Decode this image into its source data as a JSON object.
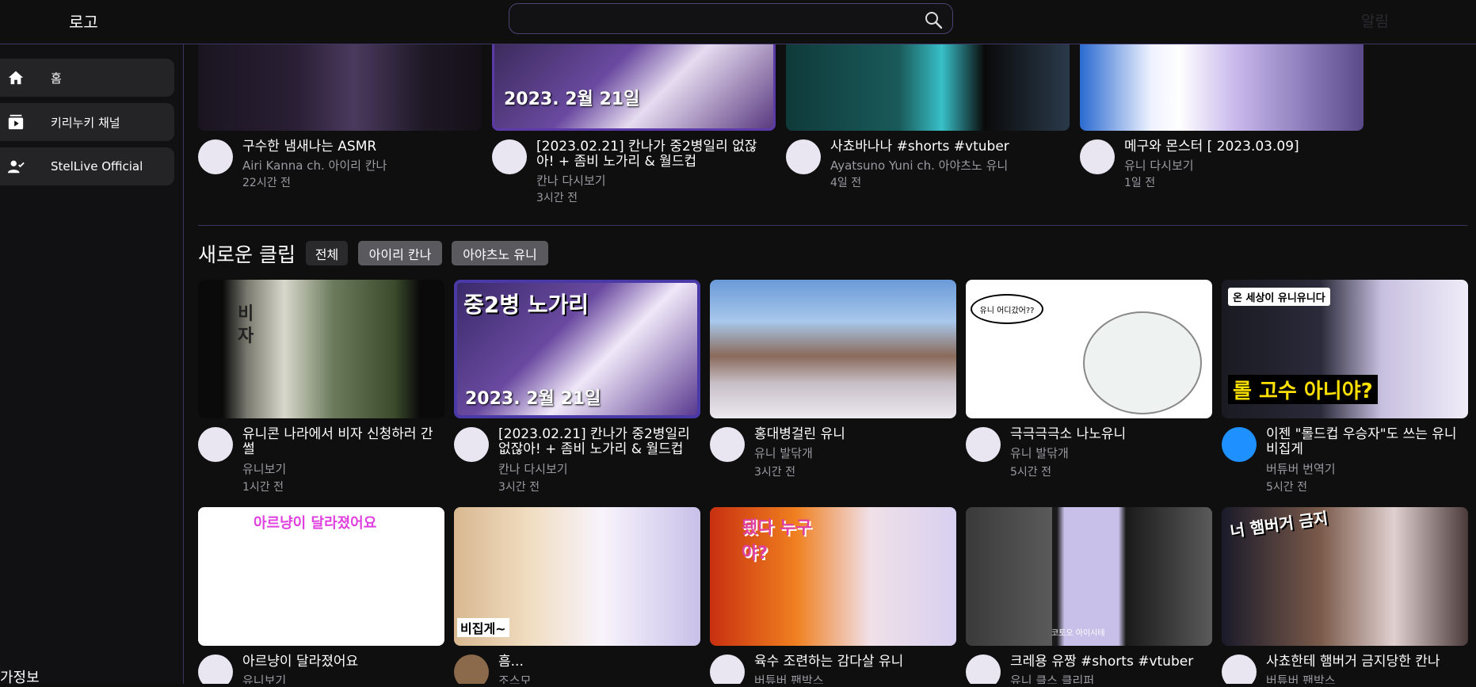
{
  "header": {
    "logo": "로고",
    "search": {
      "placeholder": "",
      "value": ""
    },
    "alarm": "알림"
  },
  "sidebar": {
    "items": [
      {
        "label": "홈",
        "icon": "home-icon"
      },
      {
        "label": "키리누키 채널",
        "icon": "subscriptions-icon"
      },
      {
        "label": "StelLive Official",
        "icon": "user-check-icon"
      }
    ],
    "footer": "가정보"
  },
  "top_videos": [
    {
      "title": "구수한 냄새나는 ASMR",
      "channel": "Airi Kanna ch. 아이리 칸나",
      "time": "22시간 전"
    },
    {
      "title": "[2023.02.21] 칸나가 중2병일리 없잖아! + 좀비 노가리 & 월드컵",
      "channel": "칸나 다시보기",
      "time": "3시간 전"
    },
    {
      "title": "사쵸바나나 #shorts #vtuber",
      "channel": "Ayatsuno Yuni ch. 아야츠노 유니",
      "time": "4일 전"
    },
    {
      "title": "메구와 몬스터 [ 2023.03.09]",
      "channel": "유니 다시보기",
      "time": "1일 전"
    }
  ],
  "clips": {
    "title": "새로운 클립",
    "filters": [
      "전체",
      "아이리 칸나",
      "아야츠노 유니"
    ],
    "row1": [
      {
        "title": "유니콘 나라에서 비자 신청하러 간 썰",
        "channel": "유니보기",
        "time": "1시간 전",
        "thumb_text": "비자"
      },
      {
        "title": "[2023.02.21] 칸나가 중2병일리 없잖아! + 좀비 노가리 & 월드컵",
        "channel": "칸나 다시보기",
        "time": "3시간 전",
        "thumb_text": "중2병 노가리",
        "thumb_date": "2023. 2월 21일"
      },
      {
        "title": "홍대병걸린 유니",
        "channel": "유니 발닦개",
        "time": "3시간 전",
        "thumb_text": ""
      },
      {
        "title": "극극극극소 나노유니",
        "channel": "유니 발닦개",
        "time": "5시간 전",
        "thumb_text": "유니 어디갔어??"
      },
      {
        "title": "이젠 \"롤드컵 우승자\"도 쓰는 유니 비집게",
        "channel": "버튜버 번역기",
        "time": "5시간 전",
        "thumb_text": "롤 고수 아니야?",
        "thumb_top": "온 세상이 유니유니다"
      }
    ],
    "row2": [
      {
        "title": "아르냥이 달라졌어요",
        "channel": "유니보기",
        "thumb_text": "아르냥이 달라졌어요"
      },
      {
        "title": "흠...",
        "channel": "조스모",
        "thumb_text": "비집게~"
      },
      {
        "title": "육수 조련하는 감다살 유니",
        "channel": "버튜버 팬박스",
        "thumb_text": "됐다 누구야?"
      },
      {
        "title": "크레용 유짱 #shorts #vtuber",
        "channel": "유니 클스 클리퍼",
        "thumb_text": "코토오 아이시테"
      },
      {
        "title": "사쵸한테 햄버거 금지당한 칸나",
        "channel": "버튜버 팬박스",
        "thumb_text": "너 햄버거 금지"
      }
    ]
  },
  "thumb_date_top": "2023. 2월 21일",
  "colors": {
    "accent": "#3b3560",
    "chip": "#5a5a5e",
    "bg": "#0f0f10"
  }
}
